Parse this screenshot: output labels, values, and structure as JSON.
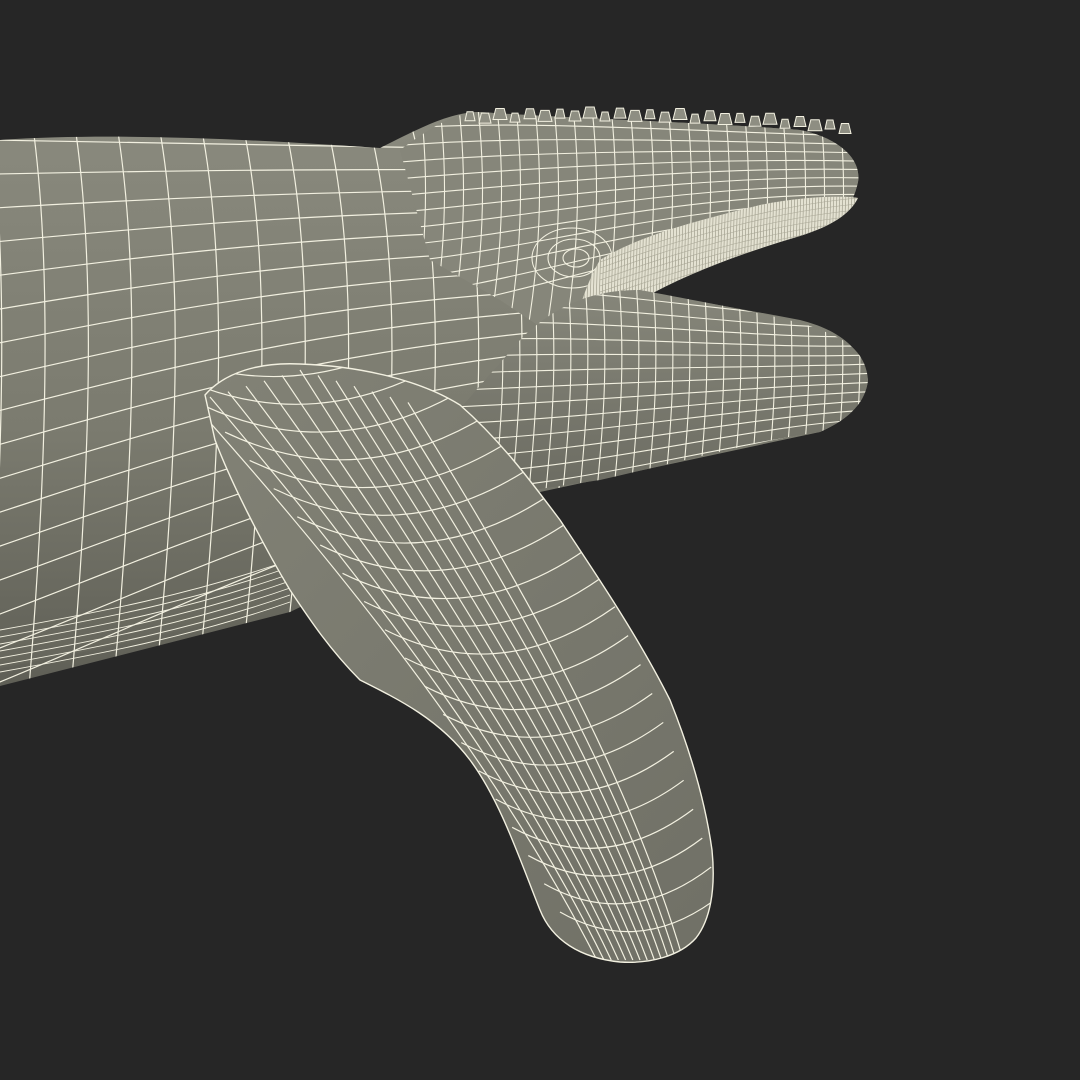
{
  "scene": {
    "subject": "humpback-whale-wireframe",
    "colors": {
      "background": "#262626",
      "surface": "#7b7b6f",
      "surface_dark": "#63635a",
      "wire": "#f2f0e0",
      "baleen": "#e4e2d2"
    }
  }
}
